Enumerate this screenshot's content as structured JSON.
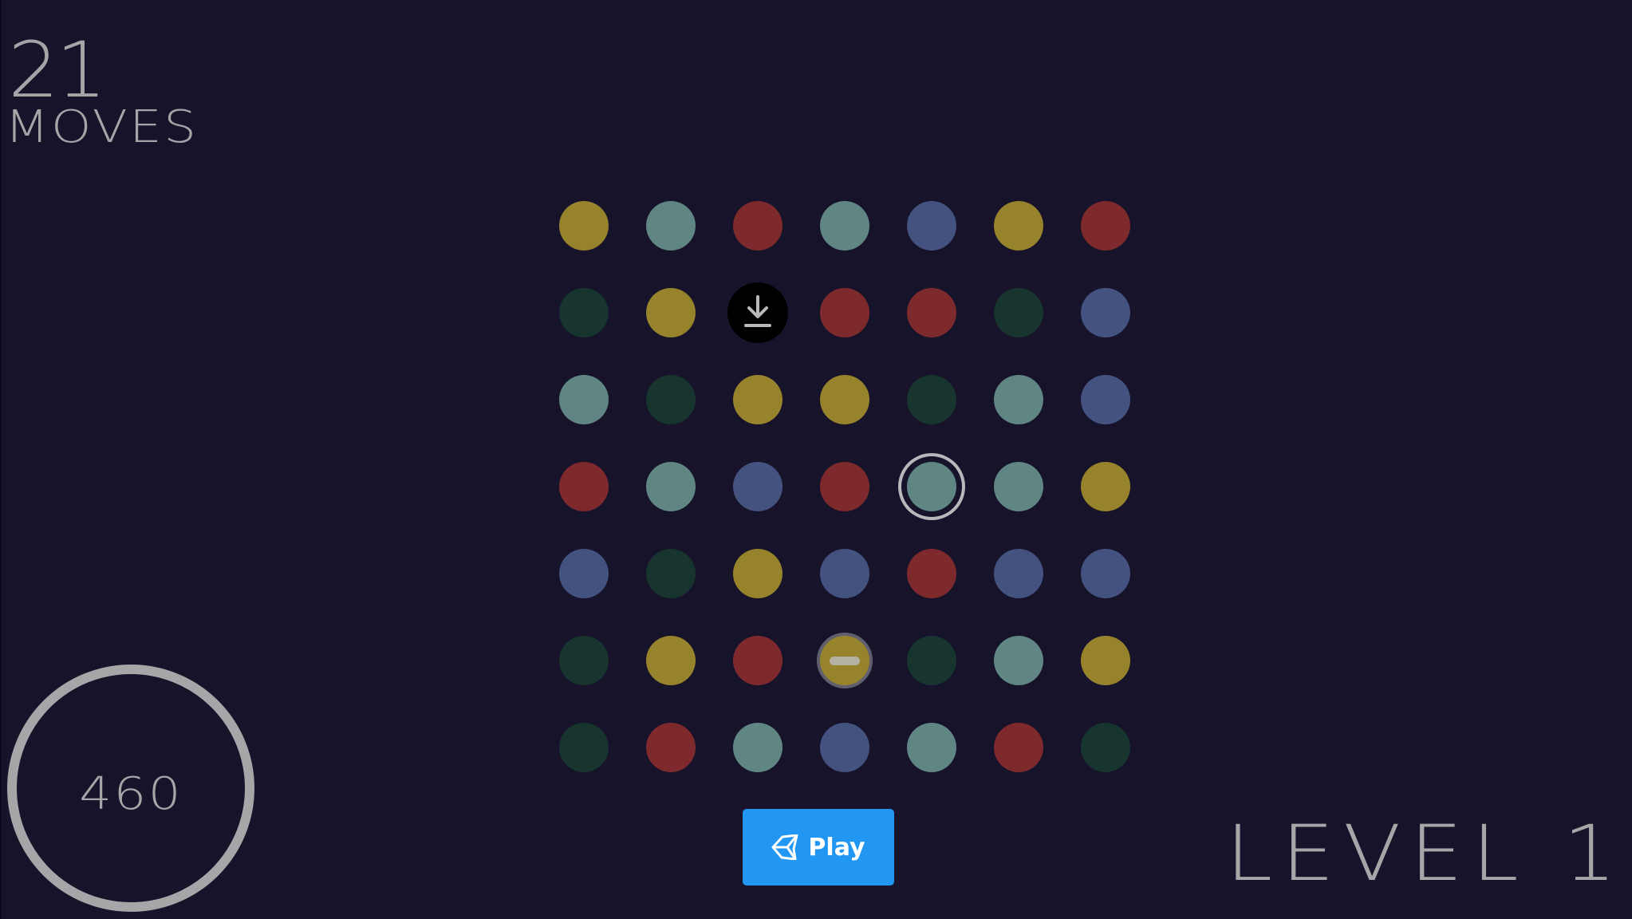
{
  "hud": {
    "moves_count": "21",
    "moves_label": "MOVES",
    "score": "460",
    "level_label": "LEVEL 1"
  },
  "play_button": {
    "label": "Play",
    "icon": "unity-logo-icon",
    "color": "#2196f3"
  },
  "colors": {
    "Y": "#97832b",
    "T": "#5f8683",
    "R": "#7e2a2d",
    "B": "#44527f",
    "G": "#17342e",
    "background": "#16132a"
  },
  "board": {
    "rows": [
      [
        "Y",
        "T",
        "R",
        "T",
        "B",
        "Y",
        "R"
      ],
      [
        "G",
        "Y",
        "bomb",
        "R",
        "R",
        "G",
        "B"
      ],
      [
        "T",
        "G",
        "Y",
        "Y",
        "G",
        "T",
        "B"
      ],
      [
        "R",
        "T",
        "B",
        "R",
        "T",
        "T",
        "Y"
      ],
      [
        "B",
        "G",
        "Y",
        "B",
        "R",
        "B",
        "B"
      ],
      [
        "G",
        "Y",
        "R",
        "minus",
        "G",
        "T",
        "Y"
      ],
      [
        "G",
        "R",
        "T",
        "B",
        "T",
        "R",
        "G"
      ]
    ],
    "selected": [
      3,
      4
    ],
    "special_tiles": {
      "bomb": {
        "icon": "download-arrow-icon",
        "color": "#000000"
      },
      "minus": {
        "icon": "minus-bar-icon",
        "color": "#97832b"
      }
    }
  }
}
